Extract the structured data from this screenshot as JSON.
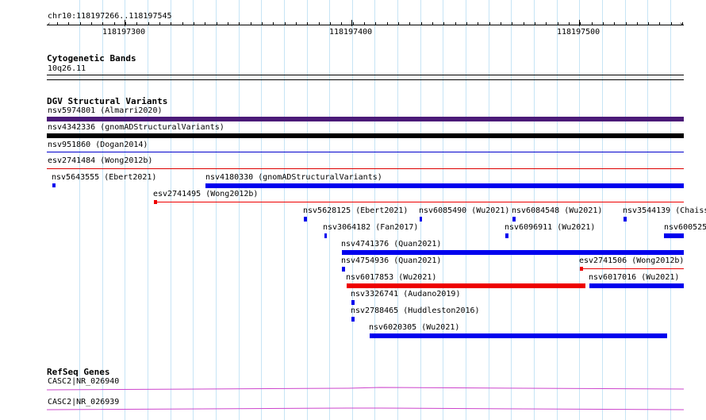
{
  "ruler": {
    "range": "chr10:118197266..118197545",
    "major_ticks": [
      "118197300",
      "118197400",
      "118197500"
    ]
  },
  "cytoband": {
    "title": "Cytogenetic Bands",
    "band": "10q26.11"
  },
  "dgv": {
    "title": "DGV Structural Variants",
    "features": [
      {
        "id": "nsv5974801 (Almarri2020)",
        "color": "#4b1a78"
      },
      {
        "id": "nsv4342336 (gnomADStructuralVariants)",
        "color": "#000000"
      },
      {
        "id": "nsv951860 (Dogan2014)",
        "color": "#0000cc"
      },
      {
        "id": "esv2741484 (Wong2012b)",
        "color": "#dd0000"
      },
      {
        "id": "nsv5643555 (Ebert2021)",
        "color": "#0000ee"
      },
      {
        "id": "nsv4180330 (gnomADStructuralVariants)",
        "color": "#0000ee"
      },
      {
        "id": "esv2741495 (Wong2012b)",
        "color": "#ee0000"
      },
      {
        "id": "nsv5628125 (Ebert2021)",
        "color": "#0000ee"
      },
      {
        "id": "nsv6085490 (Wu2021)",
        "color": "#0000ee"
      },
      {
        "id": "nsv6084548 (Wu2021)",
        "color": "#0000ee"
      },
      {
        "id": "nsv3544139 (Chaiss",
        "color": "#0000ee"
      },
      {
        "id": "nsv3064182 (Fan2017)",
        "color": "#0000ee"
      },
      {
        "id": "nsv6096911 (Wu2021)",
        "color": "#0000ee"
      },
      {
        "id": "nsv600525",
        "color": "#0000ee"
      },
      {
        "id": "nsv4741376 (Quan2021)",
        "color": "#0000ee"
      },
      {
        "id": "nsv4754936 (Quan2021)",
        "color": "#0000ee"
      },
      {
        "id": "esv2741506 (Wong2012b)",
        "color": "#ee0000"
      },
      {
        "id": "nsv6017853 (Wu2021)",
        "color": "#ee0000"
      },
      {
        "id": "nsv6017016 (Wu2021)",
        "color": "#0000ee"
      },
      {
        "id": "nsv3326741 (Audano2019)",
        "color": "#0000ee"
      },
      {
        "id": "nsv2788465 (Huddleston2016)",
        "color": "#0000ee"
      },
      {
        "id": "nsv6020305 (Wu2021)",
        "color": "#0000ee"
      }
    ]
  },
  "refseq": {
    "title": "RefSeq Genes",
    "genes": [
      {
        "id": "CASC2|NR_026940",
        "color": "#cc44cc"
      },
      {
        "id": "CASC2|NR_026939",
        "color": "#cc44cc"
      }
    ]
  }
}
